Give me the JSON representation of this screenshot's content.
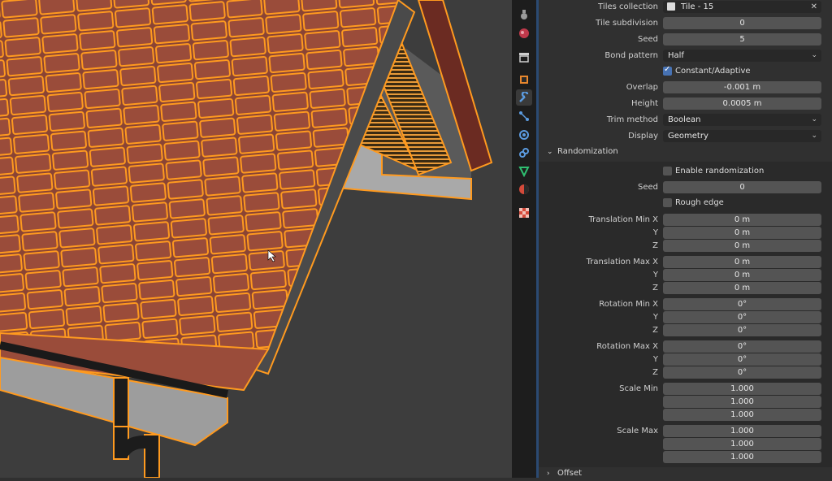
{
  "viewport": {
    "description_icon": "roof-3d-viewport"
  },
  "tabs": [
    {
      "name": "tool-icon",
      "active": false
    },
    {
      "name": "render-icon",
      "active": false
    },
    {
      "name": "world-icon",
      "active": false
    },
    {
      "name": "collection-icon",
      "active": false
    },
    {
      "name": "object-icon",
      "active": false
    },
    {
      "name": "modifier-icon",
      "active": true
    },
    {
      "name": "particles-icon",
      "active": false
    },
    {
      "name": "physics-icon",
      "active": false
    },
    {
      "name": "constraints-icon",
      "active": false
    },
    {
      "name": "data-icon",
      "active": false
    },
    {
      "name": "material-icon",
      "active": false
    },
    {
      "name": "texture-icon",
      "active": false
    }
  ],
  "props": {
    "tiles_collection": {
      "label": "Tiles collection",
      "value": "Tile - 15"
    },
    "tile_subdivision": {
      "label": "Tile subdivision",
      "value": "0"
    },
    "seed": {
      "label": "Seed",
      "value": "5"
    },
    "bond_pattern": {
      "label": "Bond pattern",
      "value": "Half"
    },
    "constant_adaptive": {
      "label": "Constant/Adaptive",
      "checked": true
    },
    "overlap": {
      "label": "Overlap",
      "value": "-0.001 m"
    },
    "height": {
      "label": "Height",
      "value": "0.0005 m"
    },
    "trim_method": {
      "label": "Trim method",
      "value": "Boolean"
    },
    "display": {
      "label": "Display",
      "value": "Geometry"
    }
  },
  "randomization": {
    "title": "Randomization",
    "enable": {
      "label": "Enable randomization",
      "checked": false
    },
    "seed": {
      "label": "Seed",
      "value": "0"
    },
    "rough_edge": {
      "label": "Rough edge",
      "checked": false
    },
    "translation_min": {
      "label": "Translation Min X",
      "y": "Y",
      "z": "Z",
      "values": [
        "0 m",
        "0 m",
        "0 m"
      ]
    },
    "translation_max": {
      "label": "Translation Max X",
      "y": "Y",
      "z": "Z",
      "values": [
        "0 m",
        "0 m",
        "0 m"
      ]
    },
    "rotation_min": {
      "label": "Rotation Min X",
      "y": "Y",
      "z": "Z",
      "values": [
        "0°",
        "0°",
        "0°"
      ]
    },
    "rotation_max": {
      "label": "Rotation Max X",
      "y": "Y",
      "z": "Z",
      "values": [
        "0°",
        "0°",
        "0°"
      ]
    },
    "scale_min": {
      "label": "Scale Min",
      "values": [
        "1.000",
        "1.000",
        "1.000"
      ]
    },
    "scale_max": {
      "label": "Scale Max",
      "values": [
        "1.000",
        "1.000",
        "1.000"
      ]
    }
  },
  "offset": {
    "title": "Offset"
  },
  "colors": {
    "accent": "#4772b3",
    "selection": "#ff9a1f",
    "tile": "#8a4434"
  }
}
